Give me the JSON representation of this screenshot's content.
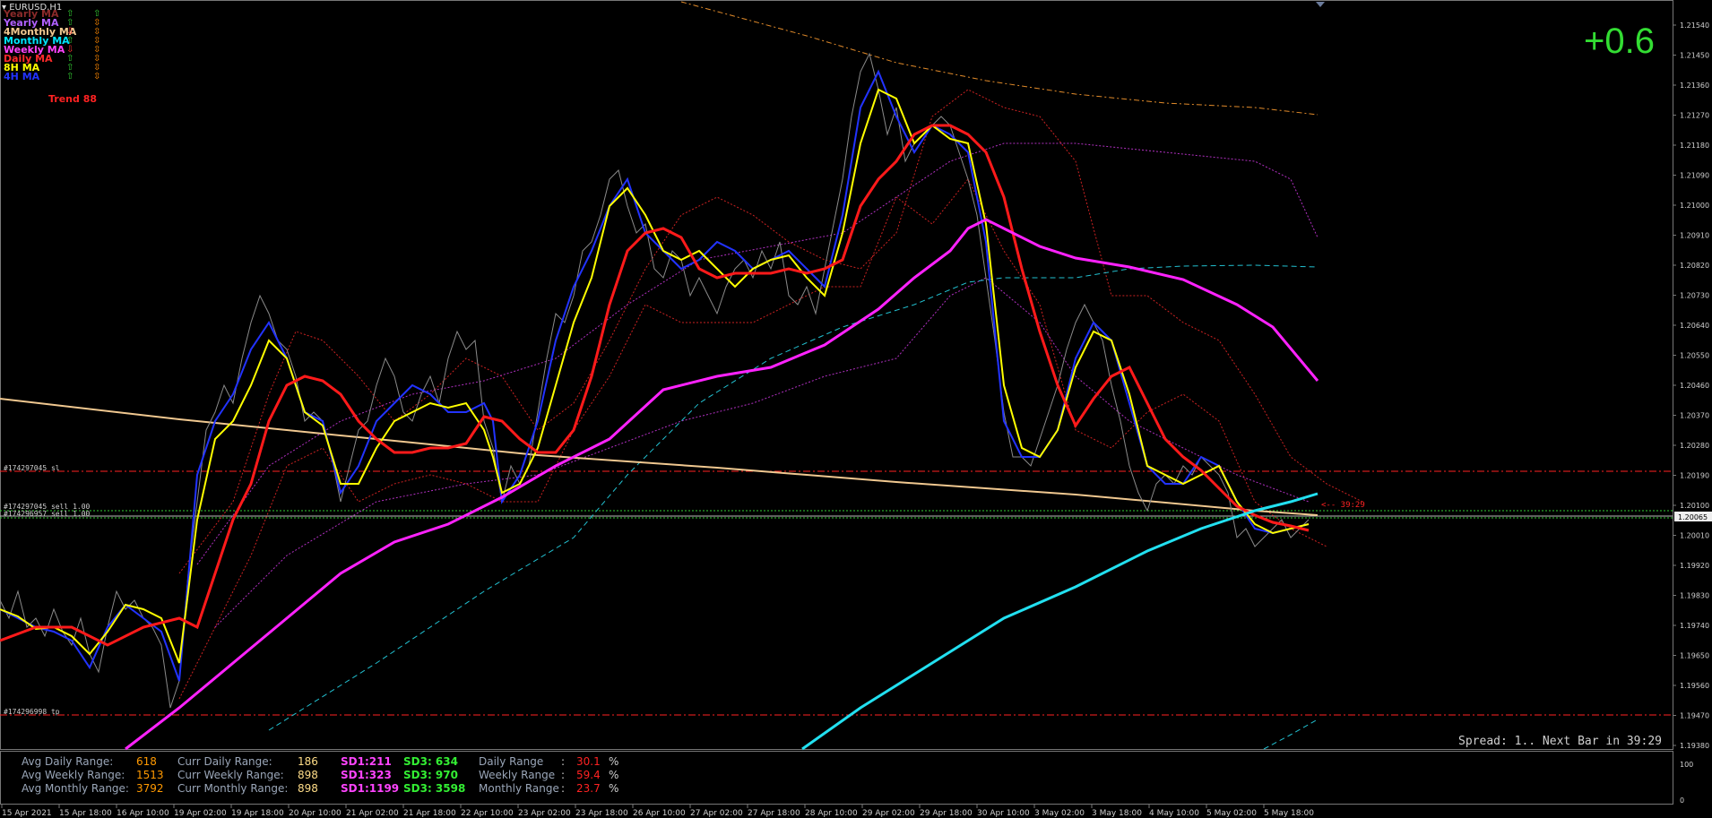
{
  "symbol": "EURUSD,H1",
  "pct_change": "+0.6",
  "trend_label": "Trend 88",
  "ma_rows": [
    {
      "label": "Yearly MA",
      "color": "#8b2a2a",
      "a1": "⇧",
      "a2": "⇧",
      "a1c": "#33cc33",
      "a2c": "#33cc33"
    },
    {
      "label": "Yearly MA",
      "color": "#b060ff",
      "a1": "⇧",
      "a2": "⇳",
      "a1c": "#33cc33",
      "a2c": "#ff8800"
    },
    {
      "label": "4Monthly MA",
      "color": "#f0c890",
      "a1": "⇩",
      "a2": "⇳",
      "a1c": "#ff3333",
      "a2c": "#ff8800"
    },
    {
      "label": "Monthly MA",
      "color": "#00e5ff",
      "a1": "⇧",
      "a2": "⇳",
      "a1c": "#33cc33",
      "a2c": "#ff8800"
    },
    {
      "label": "Weekly MA",
      "color": "#ff44ff",
      "a1": "⇩",
      "a2": "⇳",
      "a1c": "#ff3333",
      "a2c": "#ff8800"
    },
    {
      "label": "Daily MA",
      "color": "#ff2a2a",
      "a1": "⇧",
      "a2": "⇳",
      "a1c": "#33cc33",
      "a2c": "#ff8800"
    },
    {
      "label": "8H MA",
      "color": "#ffff00",
      "a1": "⇧",
      "a2": "⇳",
      "a1c": "#33cc33",
      "a2c": "#ff8800"
    },
    {
      "label": "4H MA",
      "color": "#2233ff",
      "a1": "⇧",
      "a2": "⇳",
      "a1c": "#33cc33",
      "a2c": "#ff8800"
    }
  ],
  "orders": {
    "sl": "#174297045 sl",
    "sell1": "#174297045 sell 1.00",
    "sell2": "#174296957 sell 1.00",
    "tp": "#174296998 tp"
  },
  "countdown": "<-- 39:29",
  "current_price": "1.20065",
  "spread_text": "Spread: 1.. Next Bar in 39:29",
  "stats": {
    "rows": [
      {
        "avg_label": "Avg Daily Range:",
        "avg_val": "618",
        "curr_label": "Curr Daily Range:",
        "curr_val": "186",
        "sd1": "SD1:211",
        "sd3": "SD3: 634",
        "range_label": "Daily Range",
        "range_val": "30.1",
        "pct": "%"
      },
      {
        "avg_label": "Avg Weekly Range:",
        "avg_val": "1513",
        "curr_label": "Curr Weekly Range:",
        "curr_val": "898",
        "sd1": "SD1:323",
        "sd3": "SD3: 970",
        "range_label": "Weekly Range",
        "range_val": "59.4",
        "pct": "%"
      },
      {
        "avg_label": "Avg Monthly Range:",
        "avg_val": "3792",
        "curr_label": "Curr Monthly Range:",
        "curr_val": "898",
        "sd1": "SD1:1199",
        "sd3": "SD3: 3598",
        "range_label": "Monthly Range",
        "range_val": "23.7",
        "pct": "%"
      }
    ],
    "colon": ":",
    "colors": {
      "label": "#9aa6b8",
      "avg": "#ff9900",
      "curr": "#ffdd88",
      "sd1": "#ff44ff",
      "sd3": "#33ee33",
      "range_val": "#ff2222",
      "pct": "#d0d0d0"
    }
  },
  "price_axis": [
    "1.21540",
    "1.21450",
    "1.21360",
    "1.21270",
    "1.21180",
    "1.21090",
    "1.21000",
    "1.20910",
    "1.20820",
    "1.20730",
    "1.20640",
    "1.20550",
    "1.20460",
    "1.20370",
    "1.20280",
    "1.20190",
    "1.20100",
    "1.20010",
    "1.19920",
    "1.19830",
    "1.19740",
    "1.19650",
    "1.19560",
    "1.19470",
    "1.19380"
  ],
  "sub_axis": [
    "100",
    "0"
  ],
  "time_axis": [
    "15 Apr 2021",
    "15 Apr 18:00",
    "16 Apr 10:00",
    "19 Apr 02:00",
    "19 Apr 18:00",
    "20 Apr 10:00",
    "21 Apr 02:00",
    "21 Apr 18:00",
    "22 Apr 10:00",
    "23 Apr 02:00",
    "23 Apr 18:00",
    "26 Apr 10:00",
    "27 Apr 02:00",
    "27 Apr 18:00",
    "28 Apr 10:00",
    "29 Apr 02:00",
    "29 Apr 18:00",
    "30 Apr 10:00",
    "3 May 02:00",
    "3 May 18:00",
    "4 May 10:00",
    "5 May 02:00",
    "5 May 18:00"
  ],
  "chart_data": {
    "type": "line",
    "title": "EURUSD,H1",
    "ylim": [
      1.1935,
      1.2163
    ],
    "series": [
      {
        "name": "8H MA",
        "color": "#ffff00",
        "values": [
          1.1985,
          1.1978,
          1.1968,
          1.199,
          1.1996,
          1.1966,
          1.204,
          1.206,
          1.203,
          1.204,
          1.201,
          1.204,
          1.2035,
          1.201,
          1.204,
          1.208,
          1.2105,
          1.207,
          1.208,
          1.2077,
          1.207,
          1.2113,
          1.2125,
          1.2113,
          1.211,
          1.212,
          1.206,
          1.2022,
          1.203,
          1.2062,
          1.2046,
          1.2025,
          1.2012,
          1.2005,
          1.2009
        ]
      },
      {
        "name": "Daily MA",
        "color": "#ff2a2a",
        "values": [
          1.1972,
          1.1978,
          1.1976,
          1.1978,
          1.205,
          1.2043,
          1.203,
          1.2027,
          1.2025,
          1.204,
          1.2027,
          1.204,
          1.2075,
          1.2073,
          1.208,
          1.208,
          1.21,
          1.212,
          1.2123,
          1.21,
          1.2043,
          1.2035,
          1.2045,
          1.2022,
          1.2012,
          1.201
        ]
      },
      {
        "name": "Weekly MA",
        "color": "#ff44ff",
        "values": [
          1.1943,
          1.1965,
          1.2,
          1.202,
          1.2032,
          1.205,
          1.206,
          1.2063,
          1.2075,
          1.209,
          1.21,
          1.209,
          1.208,
          1.206
        ]
      },
      {
        "name": "Monthly MA",
        "color": "#00e5ff",
        "values": [
          1.193,
          1.1973,
          1.2005,
          1.203,
          1.204,
          1.2048
        ]
      }
    ]
  }
}
